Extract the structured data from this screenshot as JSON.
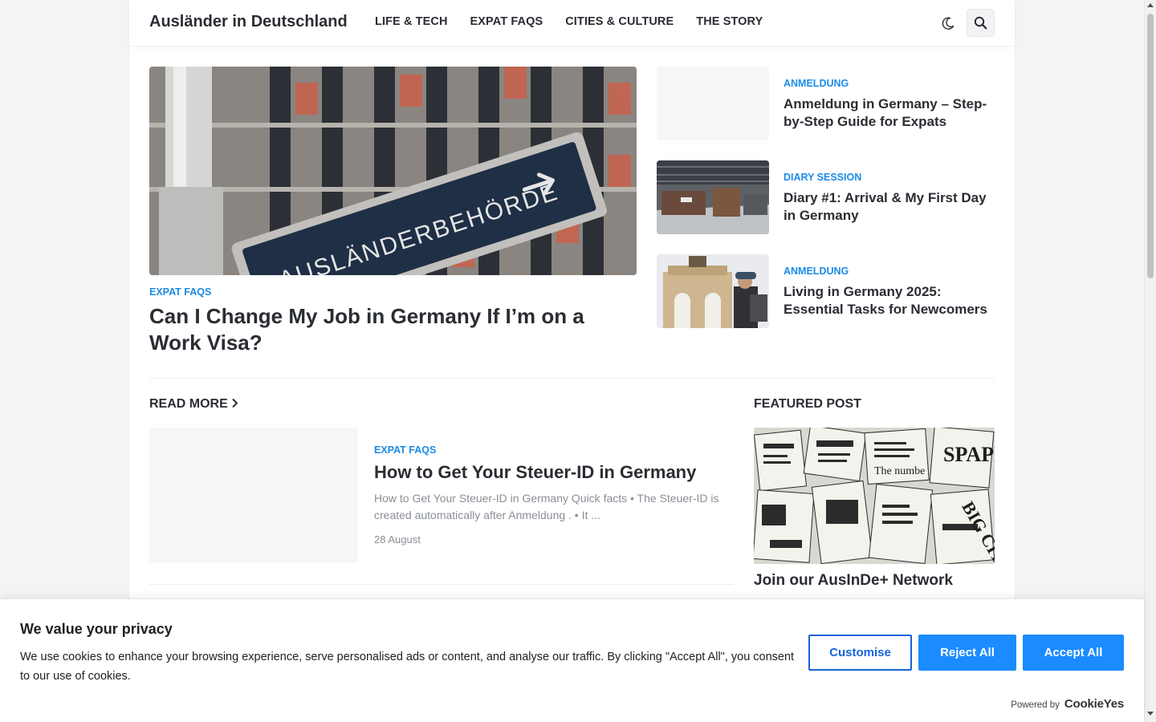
{
  "site": {
    "title": "Ausländer in Deutschland"
  },
  "nav": [
    {
      "label": "LIFE & TECH"
    },
    {
      "label": "EXPAT FAQS"
    },
    {
      "label": "CITIES & CULTURE"
    },
    {
      "label": "THE STORY"
    }
  ],
  "header": {
    "theme_icon": "moon-icon",
    "search_icon": "search-icon"
  },
  "hero": {
    "category": "EXPAT FAQS",
    "title": "Can I Change My Job in Germany If I’m on a Work Visa?",
    "image_text": "AUSLÄNDERBEHÖRDE"
  },
  "side_posts": [
    {
      "category": "ANMELDUNG",
      "title": "Anmeldung in Germany – Step-by-Step Guide for Expats"
    },
    {
      "category": "DIARY SESSION",
      "title": "Diary #1: Arrival & My First Day in Germany"
    },
    {
      "category": "ANMELDUNG",
      "title": "Living in Germany 2025: Essential Tasks for Newcomers"
    }
  ],
  "read_more": {
    "label": "READ MORE"
  },
  "featured_section": {
    "label": "FEATURED POST"
  },
  "post": {
    "category": "EXPAT FAQS",
    "title": "How to Get Your Steuer-ID in Germany",
    "excerpt": "How to Get Your Steuer-ID in Germany Quick facts • The Steuer-ID is created automatically after Anmeldung . • It ...",
    "date": "28 August"
  },
  "featured": {
    "title": "Join our AusInDe+ Network"
  },
  "cookie": {
    "title": "We value your privacy",
    "text": "We use cookies to enhance your browsing experience, serve personalised ads or content, and analyse our traffic. By clicking \"Accept All\", you consent to our use of cookies.",
    "customise": "Customise",
    "reject": "Reject All",
    "accept": "Accept All",
    "powered_by": "Powered by",
    "brand": "CookieYes"
  },
  "colors": {
    "accent": "#1b8be6",
    "button": "#1a8cff",
    "text": "#2a2d33"
  }
}
